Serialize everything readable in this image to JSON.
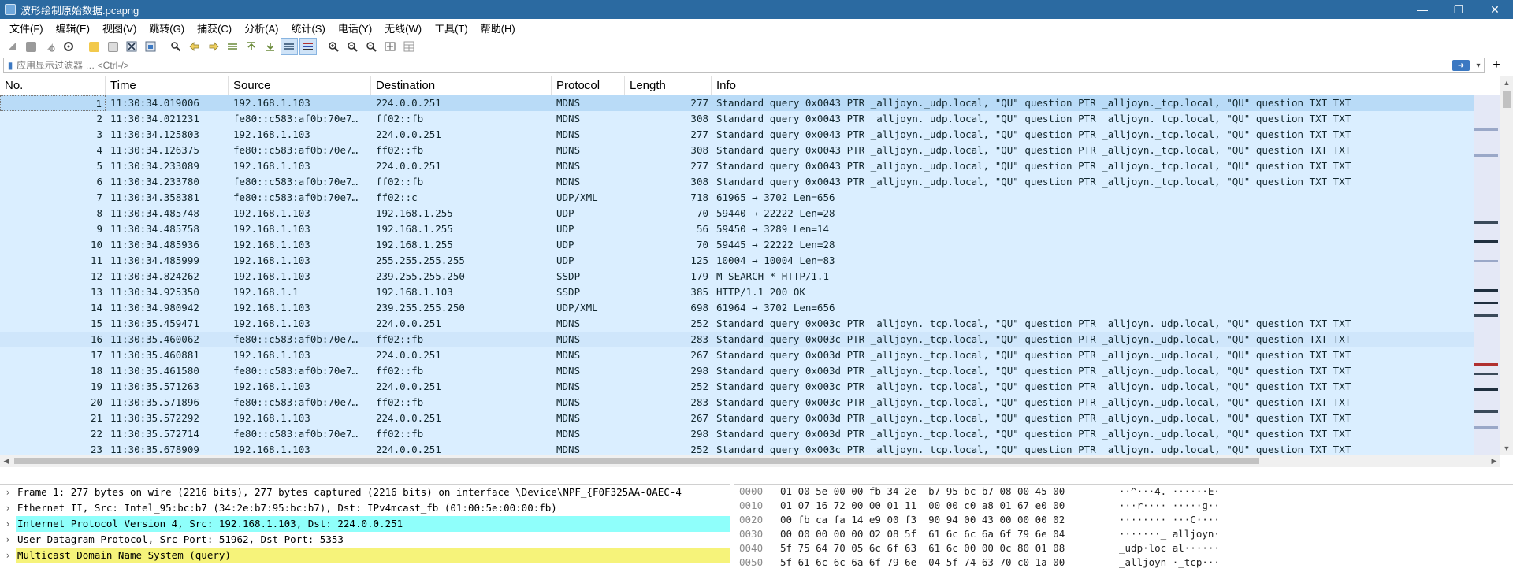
{
  "window": {
    "title": "波形绘制原始数据.pcapng",
    "controls": [
      "minimize",
      "maximize",
      "close"
    ]
  },
  "menu": [
    "文件(F)",
    "编辑(E)",
    "视图(V)",
    "跳转(G)",
    "捕获(C)",
    "分析(A)",
    "统计(S)",
    "电话(Y)",
    "无线(W)",
    "工具(T)",
    "帮助(H)"
  ],
  "toolbar": [
    "shark-fin-start-icon",
    "stop-icon",
    "restart-icon",
    "options-icon",
    "open-folder-icon",
    "save-icon",
    "close-file-icon",
    "reload-icon",
    "find-icon",
    "back-icon",
    "forward-icon",
    "goto-icon",
    "first-icon",
    "last-icon",
    "autoscroll-icon",
    "colorize-icon",
    "zoom-in-icon",
    "zoom-out-icon",
    "zoom-reset-icon",
    "resize-columns-icon",
    "layout-icon"
  ],
  "filter": {
    "placeholder": "应用显示过滤器 … <Ctrl-/>",
    "value": ""
  },
  "columns": [
    "No.",
    "Time",
    "Source",
    "Destination",
    "Protocol",
    "Length",
    "Info"
  ],
  "packets": [
    {
      "no": "1",
      "time": "11:30:34.019006",
      "src": "192.168.1.103",
      "dst": "224.0.0.251",
      "proto": "MDNS",
      "len": "277",
      "info": "Standard query 0x0043 PTR _alljoyn._udp.local, \"QU\" question PTR _alljoyn._tcp.local, \"QU\" question TXT TXT"
    },
    {
      "no": "2",
      "time": "11:30:34.021231",
      "src": "fe80::c583:af0b:70e7…",
      "dst": "ff02::fb",
      "proto": "MDNS",
      "len": "308",
      "info": "Standard query 0x0043 PTR _alljoyn._udp.local, \"QU\" question PTR _alljoyn._tcp.local, \"QU\" question TXT TXT"
    },
    {
      "no": "3",
      "time": "11:30:34.125803",
      "src": "192.168.1.103",
      "dst": "224.0.0.251",
      "proto": "MDNS",
      "len": "277",
      "info": "Standard query 0x0043 PTR _alljoyn._udp.local, \"QU\" question PTR _alljoyn._tcp.local, \"QU\" question TXT TXT"
    },
    {
      "no": "4",
      "time": "11:30:34.126375",
      "src": "fe80::c583:af0b:70e7…",
      "dst": "ff02::fb",
      "proto": "MDNS",
      "len": "308",
      "info": "Standard query 0x0043 PTR _alljoyn._udp.local, \"QU\" question PTR _alljoyn._tcp.local, \"QU\" question TXT TXT"
    },
    {
      "no": "5",
      "time": "11:30:34.233089",
      "src": "192.168.1.103",
      "dst": "224.0.0.251",
      "proto": "MDNS",
      "len": "277",
      "info": "Standard query 0x0043 PTR _alljoyn._udp.local, \"QU\" question PTR _alljoyn._tcp.local, \"QU\" question TXT TXT"
    },
    {
      "no": "6",
      "time": "11:30:34.233780",
      "src": "fe80::c583:af0b:70e7…",
      "dst": "ff02::fb",
      "proto": "MDNS",
      "len": "308",
      "info": "Standard query 0x0043 PTR _alljoyn._udp.local, \"QU\" question PTR _alljoyn._tcp.local, \"QU\" question TXT TXT"
    },
    {
      "no": "7",
      "time": "11:30:34.358381",
      "src": "fe80::c583:af0b:70e7…",
      "dst": "ff02::c",
      "proto": "UDP/XML",
      "len": "718",
      "info": "61965 → 3702 Len=656"
    },
    {
      "no": "8",
      "time": "11:30:34.485748",
      "src": "192.168.1.103",
      "dst": "192.168.1.255",
      "proto": "UDP",
      "len": "70",
      "info": "59440 → 22222 Len=28"
    },
    {
      "no": "9",
      "time": "11:30:34.485758",
      "src": "192.168.1.103",
      "dst": "192.168.1.255",
      "proto": "UDP",
      "len": "56",
      "info": "59450 → 3289 Len=14"
    },
    {
      "no": "10",
      "time": "11:30:34.485936",
      "src": "192.168.1.103",
      "dst": "192.168.1.255",
      "proto": "UDP",
      "len": "70",
      "info": "59445 → 22222 Len=28"
    },
    {
      "no": "11",
      "time": "11:30:34.485999",
      "src": "192.168.1.103",
      "dst": "255.255.255.255",
      "proto": "UDP",
      "len": "125",
      "info": "10004 → 10004 Len=83"
    },
    {
      "no": "12",
      "time": "11:30:34.824262",
      "src": "192.168.1.103",
      "dst": "239.255.255.250",
      "proto": "SSDP",
      "len": "179",
      "info": "M-SEARCH * HTTP/1.1"
    },
    {
      "no": "13",
      "time": "11:30:34.925350",
      "src": "192.168.1.1",
      "dst": "192.168.1.103",
      "proto": "SSDP",
      "len": "385",
      "info": "HTTP/1.1 200 OK"
    },
    {
      "no": "14",
      "time": "11:30:34.980942",
      "src": "192.168.1.103",
      "dst": "239.255.255.250",
      "proto": "UDP/XML",
      "len": "698",
      "info": "61964 → 3702 Len=656"
    },
    {
      "no": "15",
      "time": "11:30:35.459471",
      "src": "192.168.1.103",
      "dst": "224.0.0.251",
      "proto": "MDNS",
      "len": "252",
      "info": "Standard query 0x003c PTR _alljoyn._tcp.local, \"QU\" question PTR _alljoyn._udp.local, \"QU\" question TXT TXT"
    },
    {
      "no": "16",
      "time": "11:30:35.460062",
      "src": "fe80::c583:af0b:70e7…",
      "dst": "ff02::fb",
      "proto": "MDNS",
      "len": "283",
      "info": "Standard query 0x003c PTR _alljoyn._tcp.local, \"QU\" question PTR _alljoyn._udp.local, \"QU\" question TXT TXT"
    },
    {
      "no": "17",
      "time": "11:30:35.460881",
      "src": "192.168.1.103",
      "dst": "224.0.0.251",
      "proto": "MDNS",
      "len": "267",
      "info": "Standard query 0x003d PTR _alljoyn._tcp.local, \"QU\" question PTR _alljoyn._udp.local, \"QU\" question TXT TXT"
    },
    {
      "no": "18",
      "time": "11:30:35.461580",
      "src": "fe80::c583:af0b:70e7…",
      "dst": "ff02::fb",
      "proto": "MDNS",
      "len": "298",
      "info": "Standard query 0x003d PTR _alljoyn._tcp.local, \"QU\" question PTR _alljoyn._udp.local, \"QU\" question TXT TXT"
    },
    {
      "no": "19",
      "time": "11:30:35.571263",
      "src": "192.168.1.103",
      "dst": "224.0.0.251",
      "proto": "MDNS",
      "len": "252",
      "info": "Standard query 0x003c PTR _alljoyn._tcp.local, \"QU\" question PTR _alljoyn._udp.local, \"QU\" question TXT TXT"
    },
    {
      "no": "20",
      "time": "11:30:35.571896",
      "src": "fe80::c583:af0b:70e7…",
      "dst": "ff02::fb",
      "proto": "MDNS",
      "len": "283",
      "info": "Standard query 0x003c PTR _alljoyn._tcp.local, \"QU\" question PTR _alljoyn._udp.local, \"QU\" question TXT TXT"
    },
    {
      "no": "21",
      "time": "11:30:35.572292",
      "src": "192.168.1.103",
      "dst": "224.0.0.251",
      "proto": "MDNS",
      "len": "267",
      "info": "Standard query 0x003d PTR _alljoyn._tcp.local, \"QU\" question PTR _alljoyn._udp.local, \"QU\" question TXT TXT"
    },
    {
      "no": "22",
      "time": "11:30:35.572714",
      "src": "fe80::c583:af0b:70e7…",
      "dst": "ff02::fb",
      "proto": "MDNS",
      "len": "298",
      "info": "Standard query 0x003d PTR _alljoyn._tcp.local, \"QU\" question PTR _alljoyn._udp.local, \"QU\" question TXT TXT"
    },
    {
      "no": "23",
      "time": "11:30:35.678909",
      "src": "192.168.1.103",
      "dst": "224.0.0.251",
      "proto": "MDNS",
      "len": "252",
      "info": "Standard query 0x003c PTR _alljoyn._tcp.local, \"QU\" question PTR _alljoyn._udp.local, \"QU\" question TXT TXT"
    }
  ],
  "selected_packet": "1",
  "highlighted_packet": "16",
  "details": [
    {
      "text": "Frame 1: 277 bytes on wire (2216 bits), 277 bytes captured (2216 bits) on interface \\Device\\NPF_{F0F325AA-0AEC-4",
      "hl": ""
    },
    {
      "text": "Ethernet II, Src: Intel_95:bc:b7 (34:2e:b7:95:bc:b7), Dst: IPv4mcast_fb (01:00:5e:00:00:fb)",
      "hl": ""
    },
    {
      "text": "Internet Protocol Version 4, Src: 192.168.1.103, Dst: 224.0.0.251",
      "hl": "ip"
    },
    {
      "text": "User Datagram Protocol, Src Port: 51962, Dst Port: 5353",
      "hl": ""
    },
    {
      "text": "Multicast Domain Name System (query)",
      "hl": "mdns"
    }
  ],
  "bytes": [
    {
      "off": "0000",
      "hex": "01 00 5e 00 00 fb 34 2e  b7 95 bc b7 08 00 45 00",
      "ascii": "··^···4. ······E·"
    },
    {
      "off": "0010",
      "hex": "01 07 16 72 00 00 01 11  00 00 c0 a8 01 67 e0 00",
      "ascii": "···r···· ·····g··"
    },
    {
      "off": "0020",
      "hex": "00 fb ca fa 14 e9 00 f3  90 94 00 43 00 00 00 02",
      "ascii": "········ ···C····"
    },
    {
      "off": "0030",
      "hex": "00 00 00 00 00 02 08 5f  61 6c 6c 6a 6f 79 6e 04",
      "ascii": "·······_ alljoyn·"
    },
    {
      "off": "0040",
      "hex": "5f 75 64 70 05 6c 6f 63  61 6c 00 00 0c 80 01 08",
      "ascii": "_udp·loc al······"
    },
    {
      "off": "0050",
      "hex": "5f 61 6c 6c 6a 6f 79 6e  04 5f 74 63 70 c0 1a 00",
      "ascii": "_alljoyn ·_tcp···"
    }
  ],
  "colors": {
    "titlebar": "#2b6aa1",
    "row_bg": "#daeeff",
    "row_selected": "#b9dbf7",
    "ip_highlight": "#8ffffb",
    "mdns_highlight": "#f6f37a"
  }
}
